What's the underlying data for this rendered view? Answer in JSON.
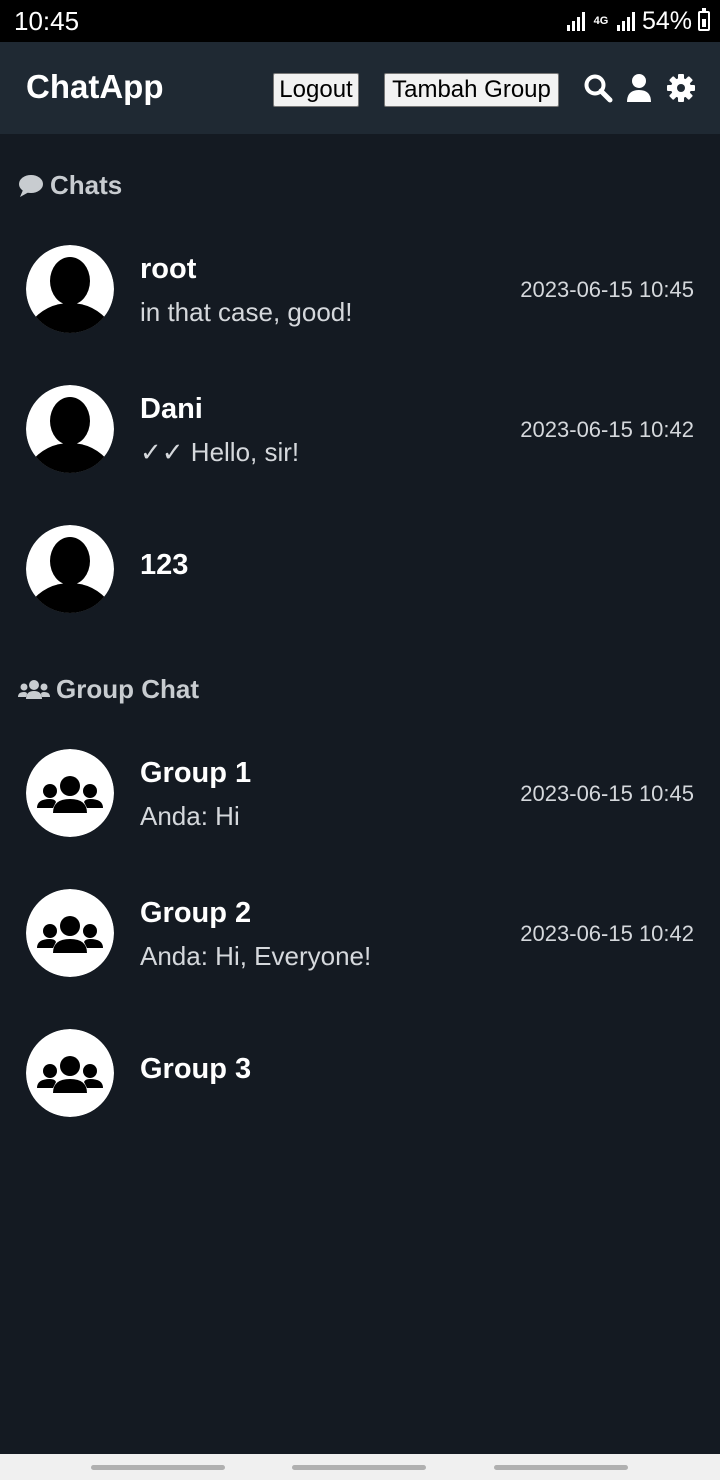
{
  "status_bar": {
    "time": "10:45",
    "network": "4G",
    "battery": "54%"
  },
  "app_bar": {
    "title": "ChatApp",
    "logout_label": "Logout",
    "add_group_label": "Tambah Group",
    "icons": [
      "search-icon",
      "user-icon",
      "gear-icon"
    ]
  },
  "chats": {
    "header": "Chats",
    "items": [
      {
        "name": "root",
        "preview": "in that case, good!",
        "time": "2023-06-15 10:45"
      },
      {
        "name": "Dani",
        "preview": "✓✓ Hello, sir!",
        "time": "2023-06-15 10:42"
      },
      {
        "name": "123",
        "preview": "",
        "time": ""
      }
    ]
  },
  "groups": {
    "header": "Group Chat",
    "items": [
      {
        "name": "Group 1",
        "preview": "Anda: Hi",
        "time": "2023-06-15 10:45"
      },
      {
        "name": "Group 2",
        "preview": "Anda: Hi, Everyone!",
        "time": "2023-06-15 10:42"
      },
      {
        "name": "Group 3",
        "preview": "",
        "time": ""
      }
    ]
  },
  "colors": {
    "background": "#141a22",
    "app_bar": "#1f2933",
    "text": "#ffffff",
    "muted_text": "#d5d8dc"
  }
}
